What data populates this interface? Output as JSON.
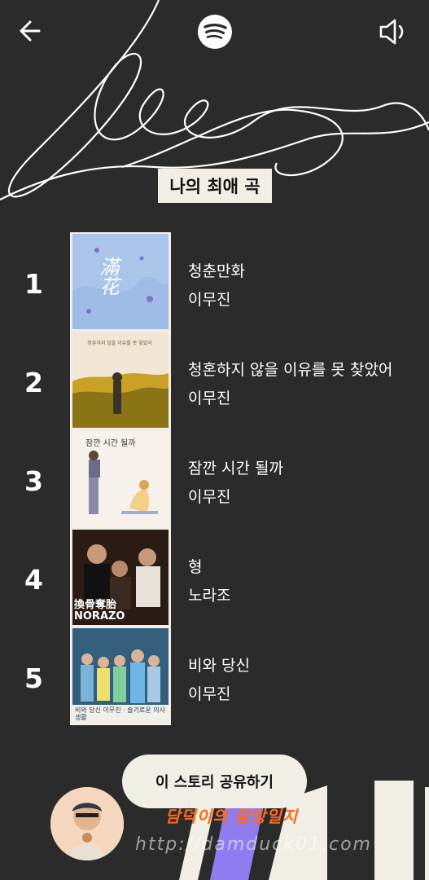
{
  "header": {
    "back_icon": "arrow-left-icon",
    "logo_icon": "spotify-logo-icon",
    "sound_icon": "speaker-icon"
  },
  "title": "나의 최애 곡",
  "tracks": [
    {
      "rank": "1",
      "title": "청춘만화",
      "artist": "이무진",
      "cover_text": "滿花"
    },
    {
      "rank": "2",
      "title": "청혼하지 않을 이유를 못 찾았어",
      "artist": "이무진",
      "cover_text": "청혼하지 않을 이유를 못 찾았어"
    },
    {
      "rank": "3",
      "title": "잠깐 시간 될까",
      "artist": "이무진",
      "cover_text": "잠깐 시간 될까"
    },
    {
      "rank": "4",
      "title": "형",
      "artist": "노라조",
      "cover_text": "換骨奪胎 NORAZO"
    },
    {
      "rank": "5",
      "title": "비와 당신",
      "artist": "이무진",
      "cover_text": "비와 당신 이무진 · 슬기로운 의사생활"
    }
  ],
  "share_label": "이 스토리 공유하기",
  "watermark": {
    "name": "담덕이의 탐방일지",
    "url": "http://damduck01.com"
  },
  "colors": {
    "background": "#2b2b2b",
    "cream": "#f1eee6",
    "accent_purple": "#8f7cf0",
    "watermark_orange": "#ff6a1a"
  }
}
